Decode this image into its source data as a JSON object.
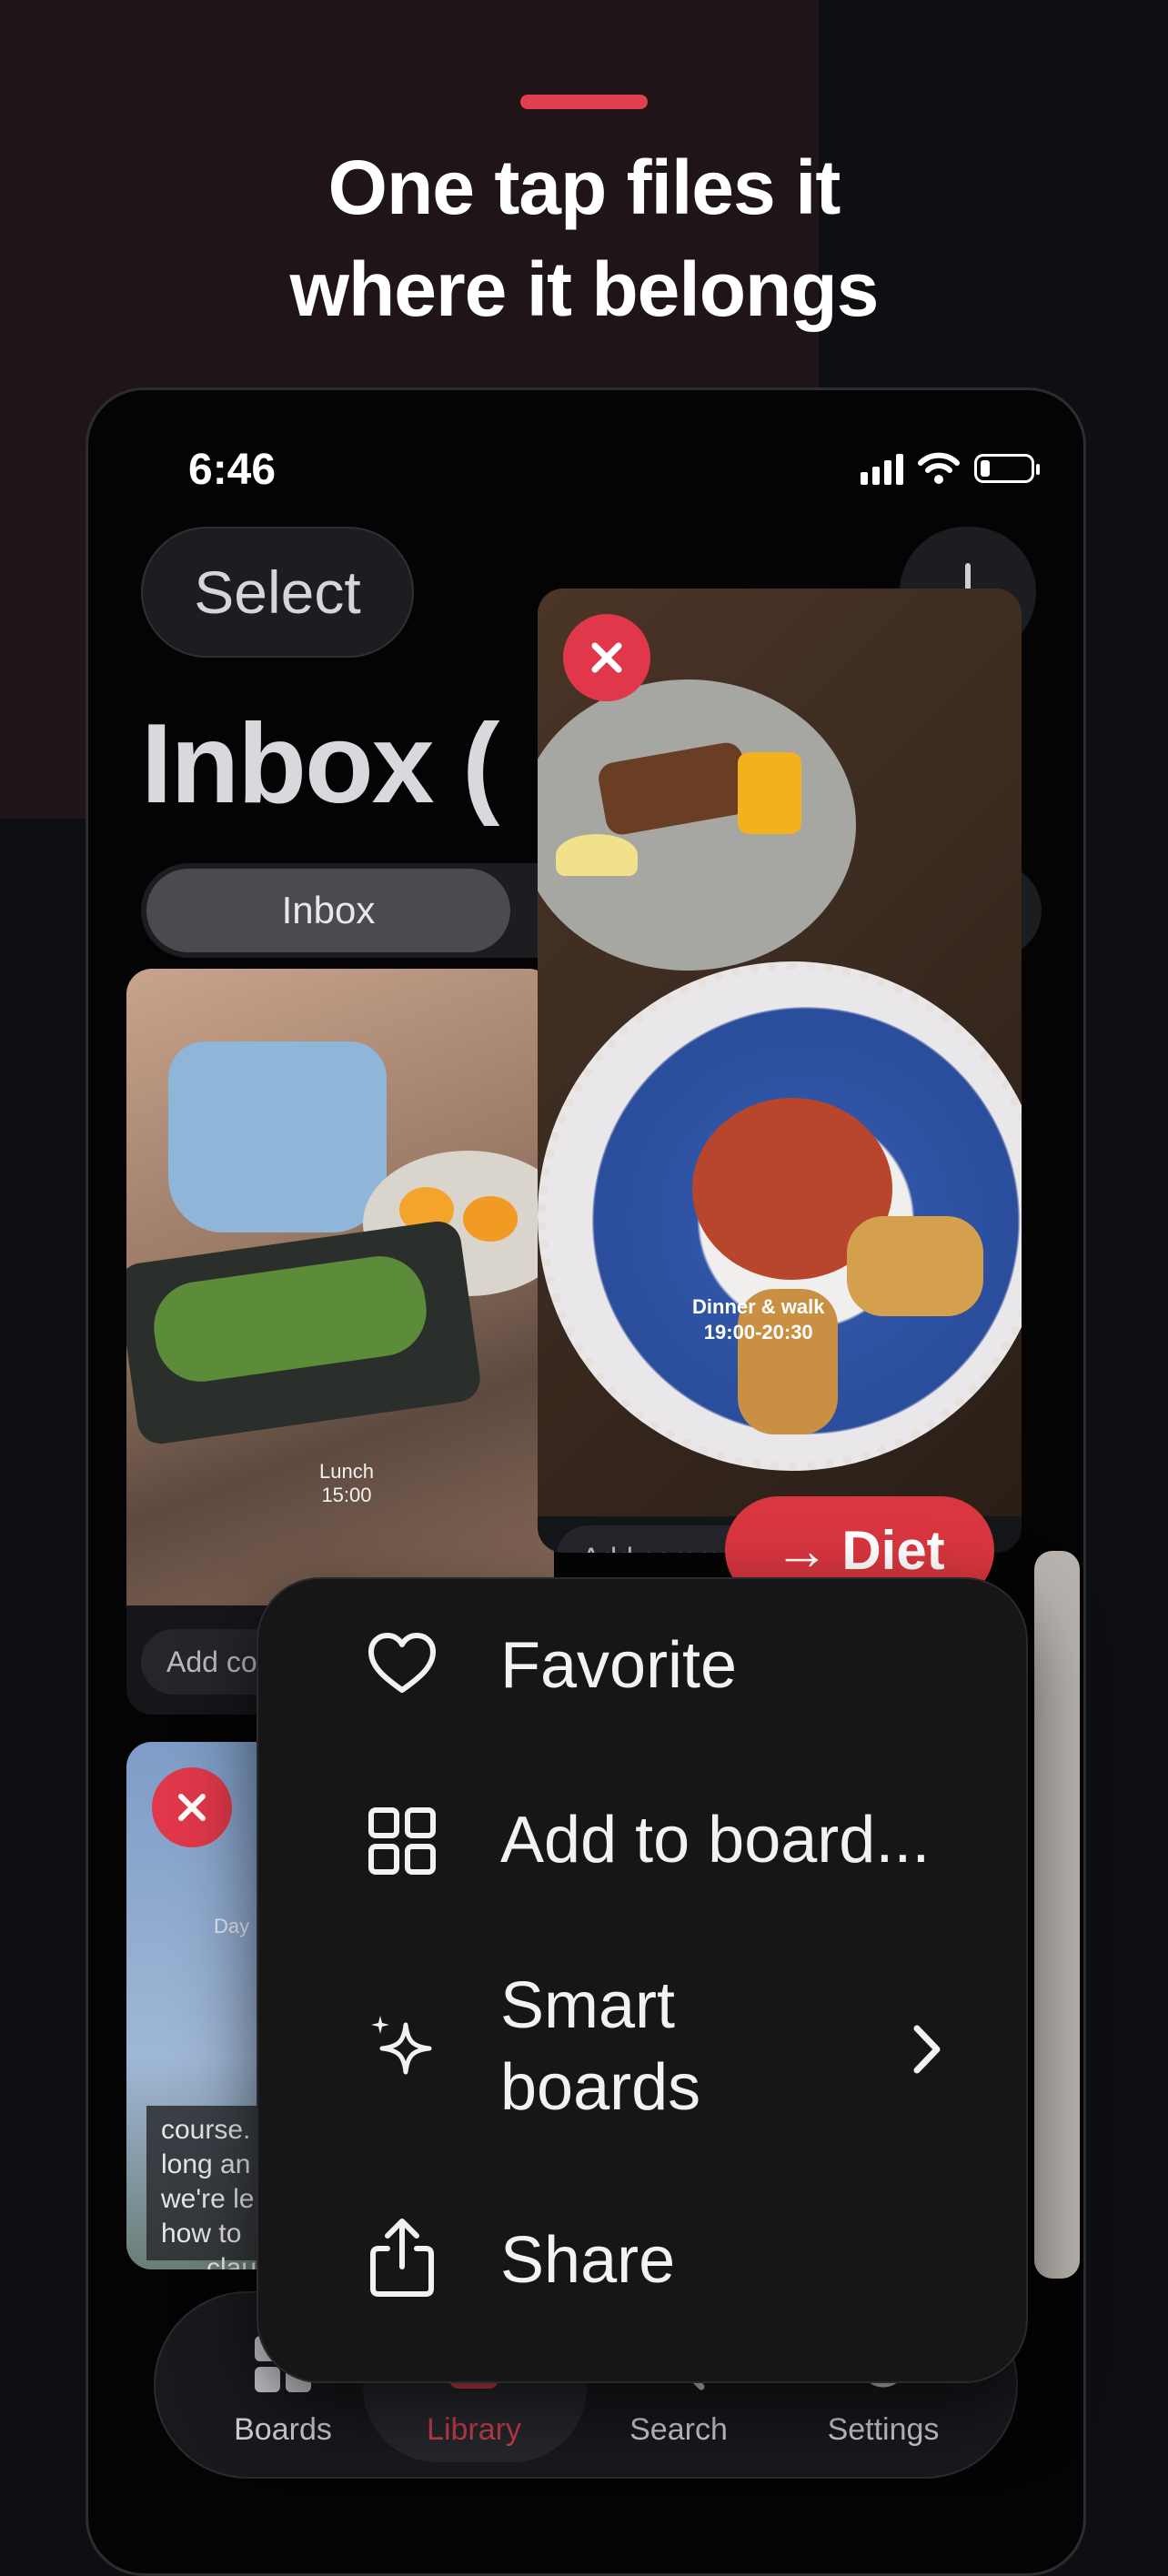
{
  "headline": {
    "line1": "One tap files it",
    "line2": "where it belongs"
  },
  "colors": {
    "accent": "#e0404f",
    "diet_pill": "#d9363f",
    "library_tab": "#c8414d"
  },
  "status_bar": {
    "time": "6:46",
    "icons": [
      "cellular-signal-icon",
      "wifi-icon",
      "battery-icon"
    ]
  },
  "header": {
    "select_label": "Select",
    "title": "Inbox (",
    "right_icon": "more-icon"
  },
  "segments": {
    "active": "Inbox"
  },
  "cards": [
    {
      "overlay_text_line1": "Lunch",
      "overlay_text_line2": "15:00",
      "comment_placeholder": "Add co"
    },
    {
      "overlay_text_line1": "Dinner & walk",
      "overlay_text_line2": "19:00-20:30",
      "comment_placeholder": "Add comm"
    },
    {
      "overlay_text_day": "Day",
      "caption_lines": [
        "course.",
        "long an",
        "we're le",
        "how to",
        "clau"
      ]
    }
  ],
  "diet_pill": {
    "arrow": "→",
    "label": "Diet"
  },
  "context_menu": {
    "items": [
      {
        "label": "Favorite",
        "icon": "heart-icon"
      },
      {
        "label": "Add to board...",
        "icon": "grid-icon"
      },
      {
        "label_line1": "Smart",
        "label_line2": "boards",
        "icon": "sparkles-icon",
        "has_submenu": true
      },
      {
        "label": "Share",
        "icon": "share-icon"
      }
    ]
  },
  "tab_bar": {
    "tabs": [
      {
        "label": "Boards",
        "icon": "boards-icon"
      },
      {
        "label": "Library",
        "icon": "library-icon",
        "active": true
      },
      {
        "label": "Search",
        "icon": "search-icon"
      },
      {
        "label": "Settings",
        "icon": "settings-icon"
      }
    ]
  }
}
